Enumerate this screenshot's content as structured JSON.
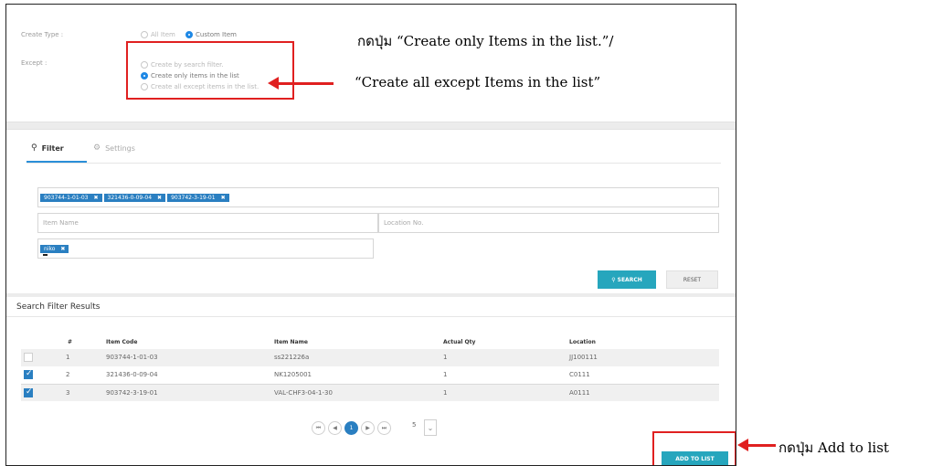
{
  "create_type": {
    "label": "Create Type :",
    "options": [
      {
        "label": "All Item",
        "selected": false
      },
      {
        "label": "Custom Item",
        "selected": true
      }
    ]
  },
  "except": {
    "label": "Except :",
    "options": [
      {
        "label": "Create by search filter.",
        "selected": false
      },
      {
        "label": "Create only items in the list",
        "selected": true
      },
      {
        "label": "Create all except items in the list.",
        "selected": false
      }
    ]
  },
  "annotations": {
    "line1": "กดปุ่ม “Create only Items in the list.”/",
    "line2": "“Create all except Items in the list”",
    "add_to_list": "กดปุ่ม Add to list"
  },
  "tabs": [
    {
      "label": "Filter",
      "icon": "search-icon",
      "active": true
    },
    {
      "label": "Settings",
      "icon": "gear-icon",
      "active": false
    }
  ],
  "filter": {
    "item_code_chips": [
      "903744-1-01-03",
      "321436-0-09-04",
      "903742-3-19-01"
    ],
    "item_name_placeholder": "Item Name",
    "location_placeholder": "Location No.",
    "extra_chips": [
      "niko"
    ],
    "search_label": "SEARCH",
    "reset_label": "RESET"
  },
  "results": {
    "title": "Search Filter Results",
    "columns": [
      "#",
      "Item Code",
      "Item Name",
      "Actual Qty",
      "Location"
    ],
    "rows": [
      {
        "checked": false,
        "no": "1",
        "code": "903744-1-01-03",
        "name": "ss221226a",
        "qty": "1",
        "location": "JJ100111"
      },
      {
        "checked": true,
        "no": "2",
        "code": "321436-0-09-04",
        "name": "NK1205001",
        "qty": "1",
        "location": "C0111"
      },
      {
        "checked": true,
        "no": "3",
        "code": "903742-3-19-01",
        "name": "VAL-CHF3-04-1-30",
        "qty": "1",
        "location": "A0111"
      }
    ]
  },
  "pagination": {
    "first": "⏮",
    "prev": "◀",
    "current": "1",
    "next": "▶",
    "last": "⏭",
    "page_size": "5"
  },
  "add_to_list_label": "ADD TO LIST",
  "colors": {
    "accent": "#26a6bd",
    "primary": "#2a7fc1",
    "annotation": "#e02020"
  }
}
